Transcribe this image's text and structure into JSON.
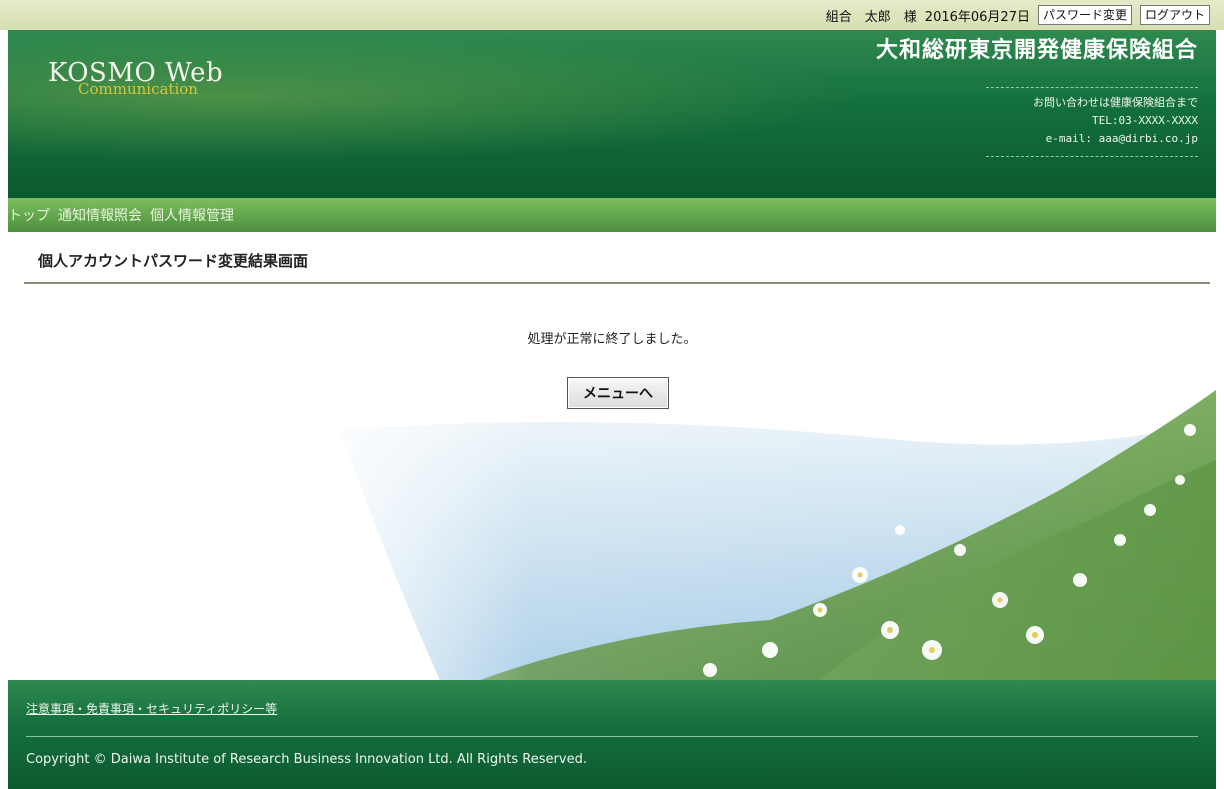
{
  "topbar": {
    "user": "組合　太郎　様",
    "date": "2016年06月27日",
    "password_change_button": "パスワード変更",
    "logout_button": "ログアウト"
  },
  "header": {
    "logo_main": "KOSMO Web",
    "logo_sub": "Communication",
    "organization": "大和総研東京開発健康保険組合",
    "contact_intro": "お問い合わせは健康保険組合まで",
    "contact_tel": "TEL:03-XXXX-XXXX",
    "contact_email": "e-mail: aaa@dirbi.co.jp"
  },
  "nav": {
    "items": [
      "トップ",
      "通知情報照会",
      "個人情報管理"
    ]
  },
  "page": {
    "title": "個人アカウントパスワード変更結果画面",
    "message": "処理が正常に終了しました。",
    "menu_button": "メニューへ"
  },
  "footer": {
    "links": "注意事項・免責事項・セキュリティポリシー等",
    "copyright": "Copyright © Daiwa Institute of Research Business Innovation Ltd. All Rights Reserved."
  },
  "colors": {
    "header_green": "#136f3d",
    "nav_green": "#5ea24a",
    "topbar_bg": "#d6dfb2"
  }
}
